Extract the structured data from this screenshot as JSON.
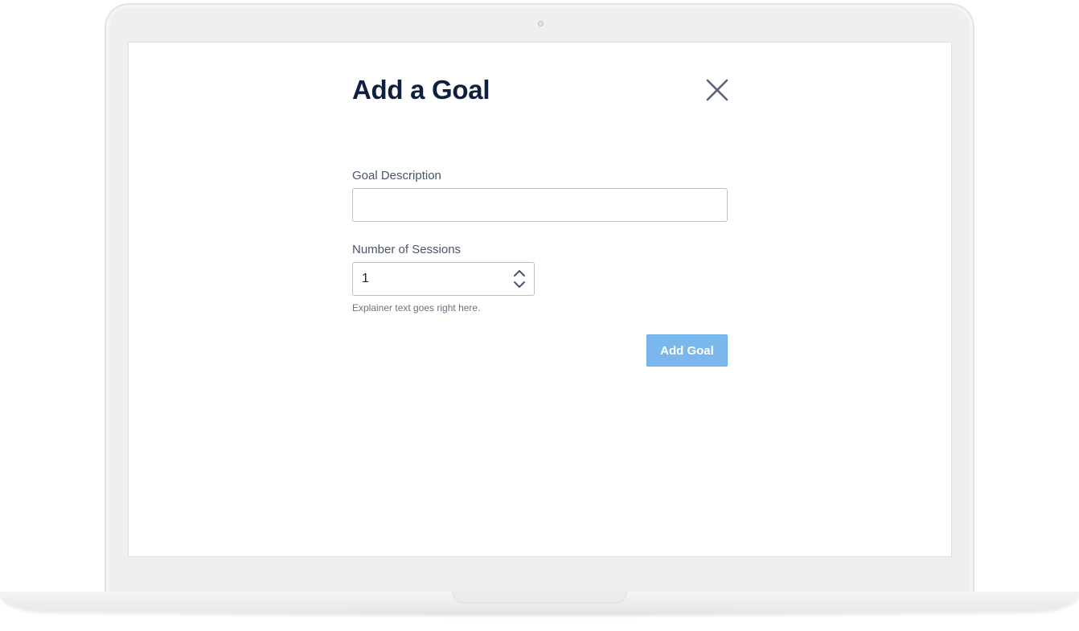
{
  "modal": {
    "title": "Add a Goal",
    "close_icon": "close-icon",
    "goal_description": {
      "label": "Goal Description",
      "value": "",
      "placeholder": ""
    },
    "sessions": {
      "label": "Number of Sessions",
      "value": "1",
      "stepper_up_icon": "chevron-up-icon",
      "stepper_down_icon": "chevron-down-icon",
      "explainer": "Explainer text goes right here."
    },
    "submit_label": "Add Goal"
  },
  "colors": {
    "title": "#0f1f3d",
    "label": "#4a5568",
    "button_bg": "#79b7ec",
    "button_text": "#ffffff",
    "input_border": "#b9bfc9",
    "icon": "#5a6577"
  }
}
